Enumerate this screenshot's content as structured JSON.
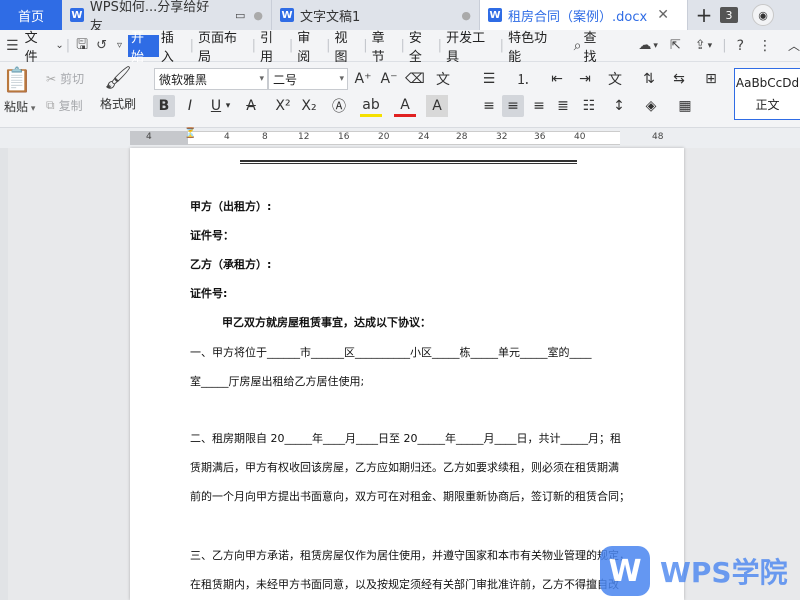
{
  "tabs": {
    "home": "首页",
    "doc1": "WPS如何...分享给好友",
    "doc2": "文字文稿1",
    "doc3": "租房合同（案例）.docx",
    "count": "3"
  },
  "menu": {
    "file": "文件",
    "items": [
      "开始",
      "插入",
      "页面布局",
      "引用",
      "审阅",
      "视图",
      "章节",
      "安全",
      "开发工具",
      "特色功能"
    ],
    "search": "查找"
  },
  "ribbon": {
    "paste": "粘贴",
    "cut": "剪切",
    "copy": "复制",
    "format_painter": "格式刷",
    "font_name": "微软雅黑",
    "font_size": "二号",
    "style_sample": "AaBbCcDd",
    "style_name": "正文"
  },
  "ruler": [
    "4",
    "4",
    "8",
    "12",
    "16",
    "20",
    "24",
    "28",
    "32",
    "36",
    "40",
    "48"
  ],
  "document": {
    "lines": [
      "甲方（出租方）:",
      "证件号：",
      "乙方（承租方）:",
      "证件号:",
      "甲乙双方就房屋租赁事宜，达成以下协议：",
      "一、甲方将位于______市______区__________小区_____栋_____单元_____室的____",
      "室_____厅房屋出租给乙方居住使用;",
      "二、租房期限自 20_____年____月____日至 20_____年_____月____日，共计_____月；租",
      "赁期满后，甲方有权收回该房屋，乙方应如期归还。乙方如要求续租，则必须在租赁期满",
      "前的一个月向甲方提出书面意向，双方可在对租金、期限重新协商后，签订新的租赁合同；",
      "三、乙方向甲方承诺，租赁房屋仅作为居住使用，并遵守国家和本市有关物业管理的规定，",
      "在租赁期内，未经甲方书面同意，以及按规定须经有关部门审批准许前，乙方不得擅自改"
    ]
  },
  "watermark": {
    "logo_letter": "W",
    "text": "WPS学院"
  }
}
